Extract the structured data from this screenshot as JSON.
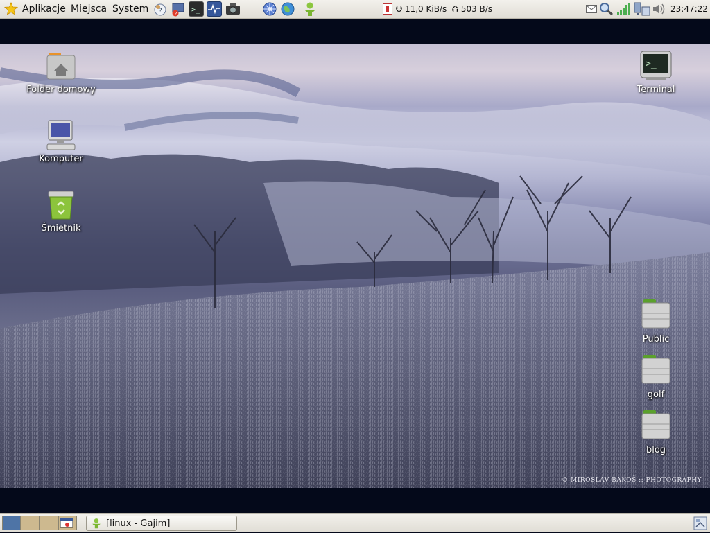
{
  "top_panel": {
    "menus": [
      "Aplikacje",
      "Miejsca",
      "System"
    ],
    "launchers": [
      "help-icon",
      "mail-client-icon",
      "terminal-icon",
      "system-monitor-icon",
      "screenshot-camera-icon",
      "network-globe-icon",
      "web-browser-icon",
      "gajim-icon"
    ],
    "netspeed": {
      "down": "11,0 KiB/s",
      "up": "503 B/s"
    },
    "clock": "23:47:22"
  },
  "desktop": {
    "icons_left": [
      "Folder domowy",
      "Komputer",
      "Śmietnik"
    ],
    "icons_right": [
      "Terminal",
      "Public",
      "golf",
      "blog"
    ],
    "credit": "© MIROSLAV BAKOŠ :: PHOTOGRAPHY"
  },
  "bottom_panel": {
    "task_title": "[linux - Gajim]"
  },
  "colors": {
    "panel": "#e8e6e0",
    "desktop_bg": "#04091a",
    "folder_green": "#5aa02c"
  }
}
